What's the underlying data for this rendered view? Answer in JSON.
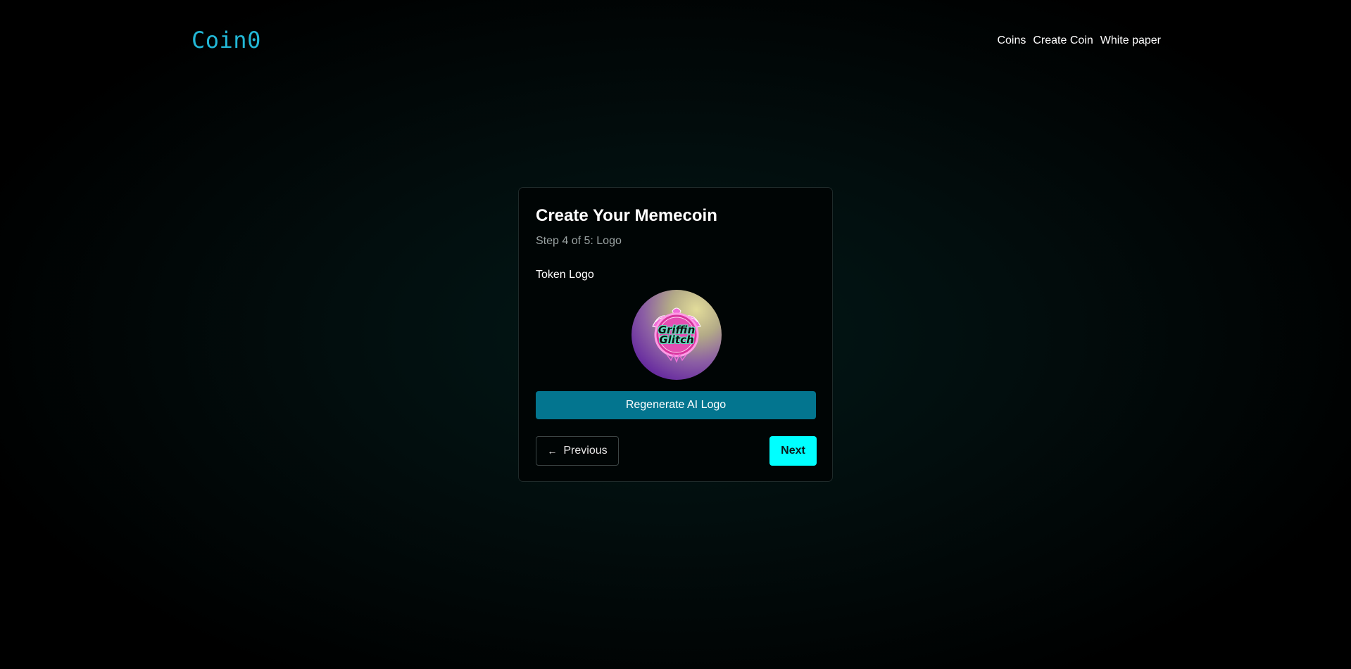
{
  "nav": {
    "brand": "Coin0",
    "links": [
      "Coins",
      "Create Coin",
      "White paper"
    ]
  },
  "wizard": {
    "title": "Create Your Memecoin",
    "step_text": "Step 4 of 5: Logo",
    "current_step": 4,
    "total_steps": 5,
    "field_label": "Token Logo",
    "logo": {
      "line1": "Griffin",
      "line2": "Glitch",
      "icon": "griffin-emblem-icon"
    },
    "regenerate_label": "Regenerate AI Logo",
    "previous_label": "Previous",
    "previous_icon": "arrow-left-icon",
    "next_label": "Next"
  },
  "colors": {
    "brand": "#22b7d6",
    "regenerate_button": "#03758f",
    "next_button": "#00ffff",
    "background": "#000505"
  }
}
